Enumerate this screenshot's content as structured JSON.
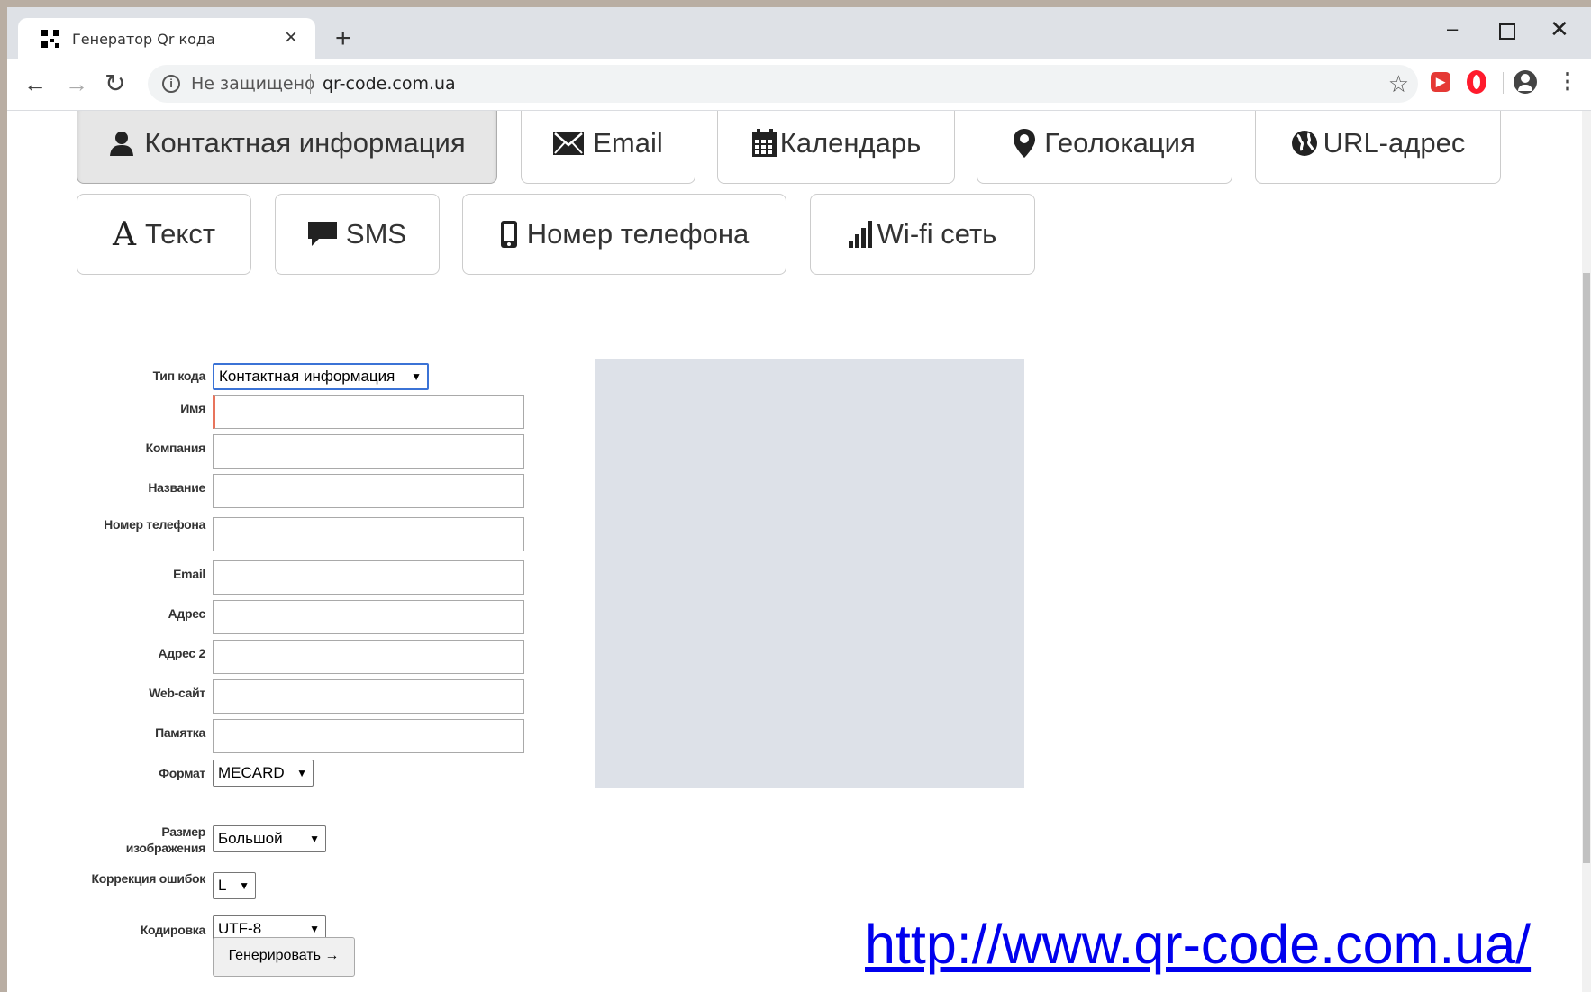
{
  "browser": {
    "tab_title": "Генератор Qr кода",
    "tab_close": "×",
    "new_tab": "+",
    "minimize": "–",
    "close": "✕",
    "security": "Не защищено",
    "url": "qr-code.com.ua",
    "bookmark_star": "☆",
    "menu": "⋮"
  },
  "type_buttons": [
    {
      "label": "Контактная информация",
      "icon": "user-icon",
      "active": true
    },
    {
      "label": "Email",
      "icon": "envelope-icon"
    },
    {
      "label": "Календарь",
      "icon": "calendar-icon"
    },
    {
      "label": "Геолокация",
      "icon": "map-marker-icon"
    },
    {
      "label": "URL-адрес",
      "icon": "globe-icon"
    },
    {
      "label": "Текст",
      "icon": "font-icon",
      "glyph": "A"
    },
    {
      "label": "SMS",
      "icon": "comment-icon"
    },
    {
      "label": "Номер телефона",
      "icon": "phone-icon"
    },
    {
      "label": "Wi-fi сеть",
      "icon": "signal-icon"
    }
  ],
  "form": {
    "code_type_label": "Тип кода",
    "code_type_value": "Контактная информация",
    "fields": [
      {
        "label": "Имя",
        "value": ""
      },
      {
        "label": "Компания",
        "value": ""
      },
      {
        "label": "Название",
        "value": ""
      },
      {
        "label": "Номер телефона",
        "value": ""
      },
      {
        "label": "Email",
        "value": ""
      },
      {
        "label": "Адрес",
        "value": ""
      },
      {
        "label": "Адрес 2",
        "value": ""
      },
      {
        "label": "Web-сайт",
        "value": ""
      },
      {
        "label": "Памятка",
        "value": ""
      }
    ],
    "format_label": "Формат",
    "format_value": "MECARD",
    "size_label": "Размер изображения",
    "size_value": "Большой",
    "correction_label": "Коррекция ошибок",
    "correction_value": "L",
    "encoding_label": "Кодировка",
    "encoding_value": "UTF-8",
    "generate_button": "Генерировать →"
  },
  "site_link": "http://www.qr-code.com.ua/",
  "colors": {
    "link": "#0000ee",
    "qr_placeholder": "#dde1e8",
    "focus_accent": "#e8745c",
    "select_focus": "#3b73d6"
  }
}
